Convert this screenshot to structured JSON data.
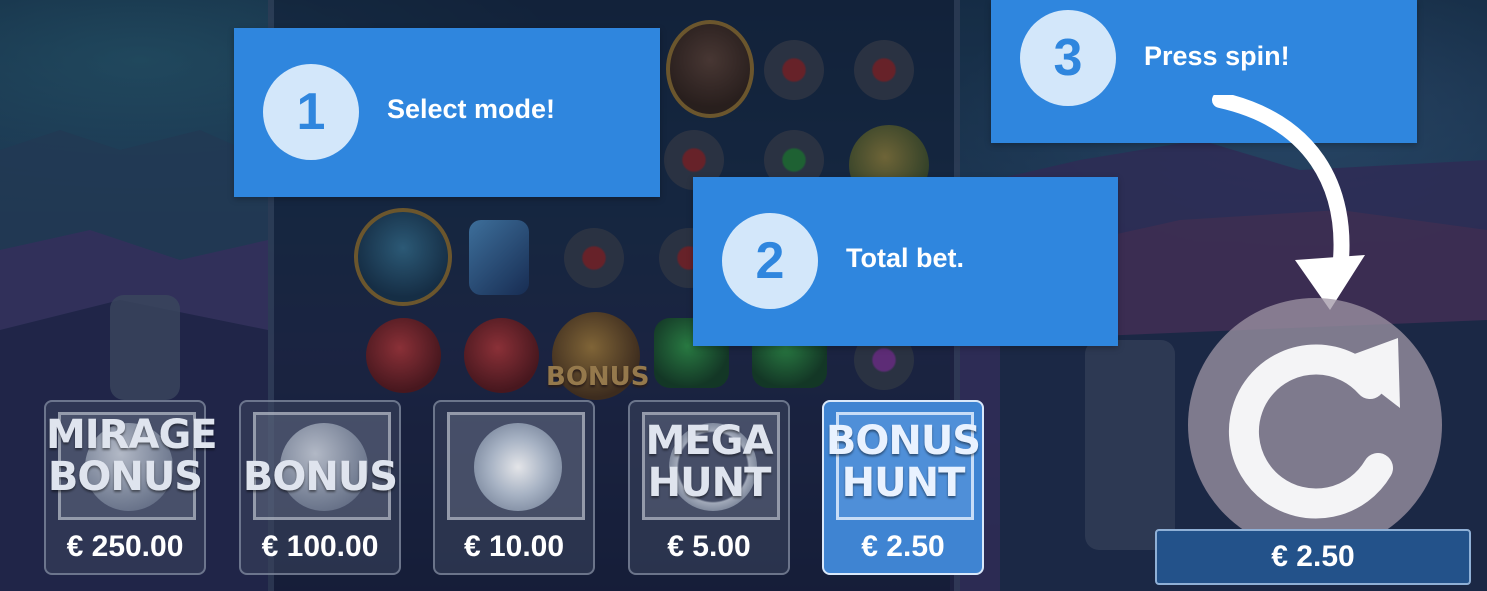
{
  "steps": [
    {
      "number": "1",
      "text": "Select mode!"
    },
    {
      "number": "2",
      "text": "Total bet."
    },
    {
      "number": "3",
      "text": "Press spin!"
    }
  ],
  "modes": [
    {
      "title_line1": "MIRAGE",
      "title_line2": "BONUS",
      "price": "€ 250.00",
      "selected": false
    },
    {
      "title_line1": "",
      "title_line2": "BONUS",
      "price": "€ 100.00",
      "selected": false
    },
    {
      "title_line1": "",
      "title_line2": "",
      "price": "€ 10.00",
      "selected": false
    },
    {
      "title_line1": "MEGA",
      "title_line2": "HUNT",
      "price": "€ 5.00",
      "selected": false
    },
    {
      "title_line1": "BONUS",
      "title_line2": "HUNT",
      "price": "€ 2.50",
      "selected": true
    }
  ],
  "reel_symbol_text": "BONUS",
  "total_bet": "€ 2.50",
  "icons": {
    "spin": "spin-arrow-icon",
    "pointer": "curved-arrow-icon"
  },
  "colors": {
    "tip_background": "#2f86de",
    "tip_number_circle": "#d3e7fa",
    "selected_mode": "#3f84d2",
    "bet_box": "#23528a"
  }
}
